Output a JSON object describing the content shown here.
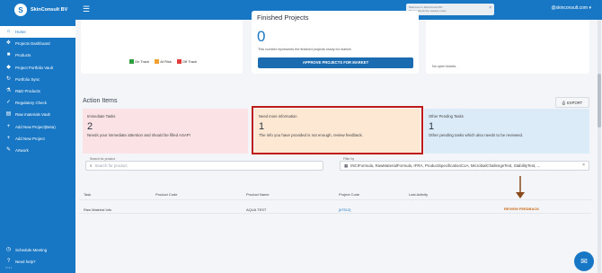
{
  "app": {
    "brand_name": "SkinConsult BV",
    "logo_letter": "S"
  },
  "topbar": {
    "notice_line1": "Welcome to SkinConsult BV",
    "notice_line2": "Please check the release notes",
    "user": "@skinconsult.com"
  },
  "sidebar": {
    "items": [
      {
        "label": "Home",
        "icon": "home-icon",
        "glyph": "⌂"
      },
      {
        "label": "Projects Dashboard",
        "icon": "dashboard-icon",
        "glyph": "❖"
      },
      {
        "label": "Products",
        "icon": "products-icon",
        "glyph": "■"
      },
      {
        "label": "Project Portfolio Vault",
        "icon": "vault-icon",
        "glyph": "◆"
      },
      {
        "label": "Portfolio Sync",
        "icon": "sync-icon",
        "glyph": "↻"
      },
      {
        "label": "R&D Products",
        "icon": "flask-icon",
        "glyph": "⚗"
      },
      {
        "label": "Regulatory Check",
        "icon": "check-icon",
        "glyph": "✓"
      },
      {
        "label": "Raw materials Vault",
        "icon": "materials-icon",
        "glyph": "▤"
      },
      {
        "label": "Add New Project(Beta)",
        "icon": "add-icon",
        "glyph": "+"
      },
      {
        "label": "Add New Project",
        "icon": "add-icon",
        "glyph": "+"
      },
      {
        "label": "Artwork",
        "icon": "artwork-icon",
        "glyph": "✎"
      }
    ],
    "bottom": [
      {
        "label": "Schedule Meeting",
        "icon": "calendar-icon",
        "glyph": "◷"
      },
      {
        "label": "Need help?",
        "icon": "help-icon",
        "glyph": "?"
      }
    ],
    "version": "v2.4.1"
  },
  "legend": {
    "on_track": "On Track",
    "at_risk": "At Risk",
    "off_track": "Off Track",
    "colors": {
      "on_track": "#2e9e3f",
      "at_risk": "#f0a030",
      "off_track": "#e23b3b"
    }
  },
  "finished_projects": {
    "title": "Finished Projects",
    "count": "0",
    "description": "This number represents the finished projects ready for market.",
    "button": "APPROVE PROJECTS FOR MARKET"
  },
  "tickets": {
    "empty": "No open tickets."
  },
  "action_items": {
    "title": "Action Items",
    "export": "EXPORT",
    "tasks": [
      {
        "title": "Immediate Tasks",
        "count": "2",
        "description": "Needs your immediate attention and should be filled ASAP!"
      },
      {
        "title": "Need more information",
        "count": "1",
        "description": "The info you have provided is not enough, review feedback."
      },
      {
        "title": "Other Pending Tasks",
        "count": "1",
        "description": "Other pending tasks which also needs to be reviewed."
      }
    ]
  },
  "search": {
    "label": "Search for product",
    "placeholder": "Search for product"
  },
  "filter": {
    "label": "Filter by",
    "value": "INCIFormula, RawMaterialFormula, IFRA, ProductSpecificationCoA, MicrobialChallengeTest, StabilityTest, ..."
  },
  "table": {
    "headers": [
      "Task",
      "Product Code",
      "Product Name",
      "Project Code",
      "Last Activity"
    ],
    "rows": [
      {
        "task": "Raw Material Info",
        "product_code": "",
        "product_name": "AQUA TEST",
        "project_code": "[#7512]",
        "last_activity": "",
        "action": "REVIEW FEEDBACK"
      }
    ]
  }
}
